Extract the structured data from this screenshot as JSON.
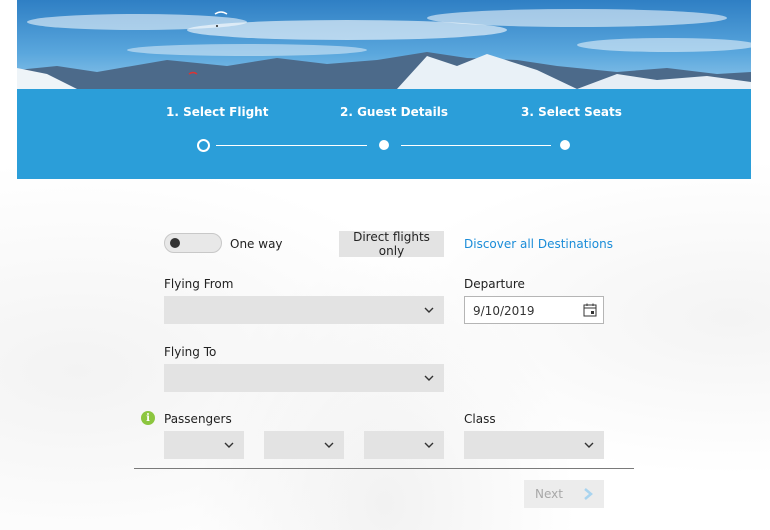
{
  "steps": [
    {
      "label": "1. Select Flight",
      "state": "current"
    },
    {
      "label": "2. Guest Details",
      "state": "upcoming"
    },
    {
      "label": "3. Select Seats",
      "state": "upcoming"
    }
  ],
  "options": {
    "trip_toggle_label": "One way",
    "trip_toggle_on": false,
    "direct_flights_label": "Direct flights only",
    "discover_link": "Discover all Destinations"
  },
  "form": {
    "flying_from_label": "Flying From",
    "flying_from_value": "",
    "departure_label": "Departure",
    "departure_value": "9/10/2019",
    "flying_to_label": "Flying To",
    "flying_to_value": "",
    "passengers_label": "Passengers",
    "passenger_selects": [
      "",
      "",
      ""
    ],
    "class_label": "Class",
    "class_value": ""
  },
  "footer": {
    "next_label": "Next"
  },
  "colors": {
    "accent": "#2b9ed9",
    "link": "#1a8cd8",
    "info": "#8cc63f",
    "field_bg": "#e3e3e3"
  }
}
